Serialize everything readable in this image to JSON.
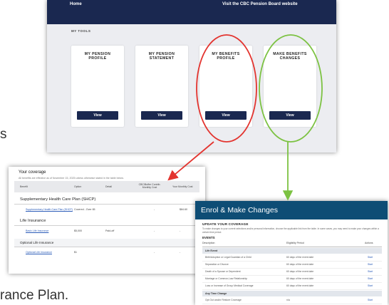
{
  "background_text": {
    "cut_left": "s",
    "cut_bottom": "rance Plan."
  },
  "portal": {
    "home": "Home",
    "external_link": "Visit the CBC Pension Board website",
    "section_label": "MY TOOLS",
    "tiles": [
      {
        "title": "MY PENSION\nPROFILE",
        "button": "View"
      },
      {
        "title": "MY PENSION\nSTATEMENT",
        "button": "View"
      },
      {
        "title": "MY BENEFITS\nPROFILE",
        "button": "View"
      },
      {
        "title": "MAKE BENEFITS\nCHANGES",
        "button": "View"
      }
    ]
  },
  "coverage": {
    "title": "Your coverage",
    "subtitle": "All benefits are effective as of November 15, 2025 unless otherwise stated in the table below.",
    "headers": [
      "Benefit",
      "Option",
      "Detail",
      "CBC/Buffer Contrib. Monthly Cost",
      "Your Monthly Cost"
    ],
    "sections": [
      {
        "name": "Supplementary Health Care Plan (SHCP)",
        "rows": [
          {
            "benefit": "Supplementary Health Care Plan (SHCP)",
            "option": "Covered - Over 65",
            "detail": "",
            "cbc": "-",
            "yours": "$84.60"
          }
        ]
      },
      {
        "name": "Life Insurance",
        "rows": [
          {
            "benefit": "Basic Life Insurance",
            "option": "$5,000",
            "detail": "Paid-off",
            "cbc": "-",
            "yours": "-"
          }
        ]
      },
      {
        "name": "Optional Life Insurance",
        "rows": [
          {
            "benefit": "Optional Life Insurance",
            "option": "$1",
            "detail": "",
            "cbc": "-",
            "yours": "-"
          }
        ]
      }
    ]
  },
  "enrol": {
    "header": "Enrol & Make Changes",
    "update_title": "UPDATE YOUR COVERAGE",
    "update_text": "To make changes to your current selections and/or personal information, choose the applicable link from the table. In some cases, you may need to make your changes within a certain time period.",
    "events_title": "EVENTS",
    "columns": [
      "Description",
      "Eligibility Period",
      "Actions"
    ],
    "groups": [
      {
        "name": "Life Event",
        "rows": [
          {
            "desc": "Birth/Adoption or Legal Guardian of a Child",
            "period": "60 days of the event date",
            "action": "Start"
          },
          {
            "desc": "Separation or Divorce",
            "period": "60 days of the event date",
            "action": "Start"
          },
          {
            "desc": "Death of a Spouse or Dependent",
            "period": "60 days of the event date",
            "action": "Start"
          },
          {
            "desc": "Marriage or Common-Law Relationship",
            "period": "60 days of the event date",
            "action": "Start"
          },
          {
            "desc": "Loss or Increase of Group Medical Coverage",
            "period": "60 days of the event date",
            "action": "Start"
          }
        ]
      },
      {
        "name": "Any Time Change",
        "rows": [
          {
            "desc": "Opt Out and/or Restore Coverage",
            "period": "n/a",
            "action": "Start"
          }
        ]
      }
    ]
  },
  "colors": {
    "navy": "#1a2850",
    "teal_header": "#0e4d75",
    "red_annotation": "#e3342f",
    "green_annotation": "#7cc242"
  }
}
